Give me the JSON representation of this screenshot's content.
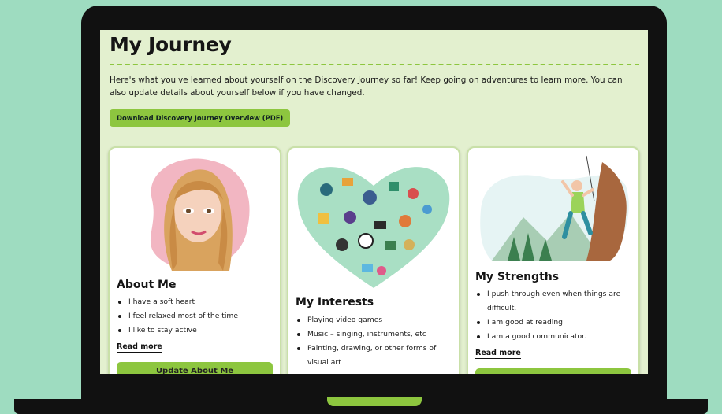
{
  "page": {
    "title": "My Journey",
    "intro": "Here's what you've learned about yourself on the Discovery Journey so far! Keep going on adventures to learn more. You can also update details about yourself below if you have changed.",
    "download_label": "Download Discovery Journey Overview (PDF)"
  },
  "cards": {
    "about": {
      "title": "About Me",
      "items": [
        "I have a soft heart",
        "I feel relaxed most of the time",
        "I like to stay active"
      ],
      "read_more": "Read more",
      "button": "Update About Me"
    },
    "interests": {
      "title": "My Interests",
      "items": [
        "Playing video games",
        "Music – singing, instruments, etc",
        "Painting, drawing, or other forms of visual art"
      ]
    },
    "strengths": {
      "title": "My Strengths",
      "items": [
        "I push through even when things are difficult.",
        "I am good at reading.",
        "I am a good communicator."
      ],
      "read_more": "Read more"
    }
  },
  "colors": {
    "background": "#9edcc0",
    "screen": "#e3f0cf",
    "accent": "#8dc63f",
    "card_border": "#c9e0a8"
  },
  "icons": [
    "avatar-illustration",
    "interests-heart-illustration",
    "climber-illustration"
  ]
}
